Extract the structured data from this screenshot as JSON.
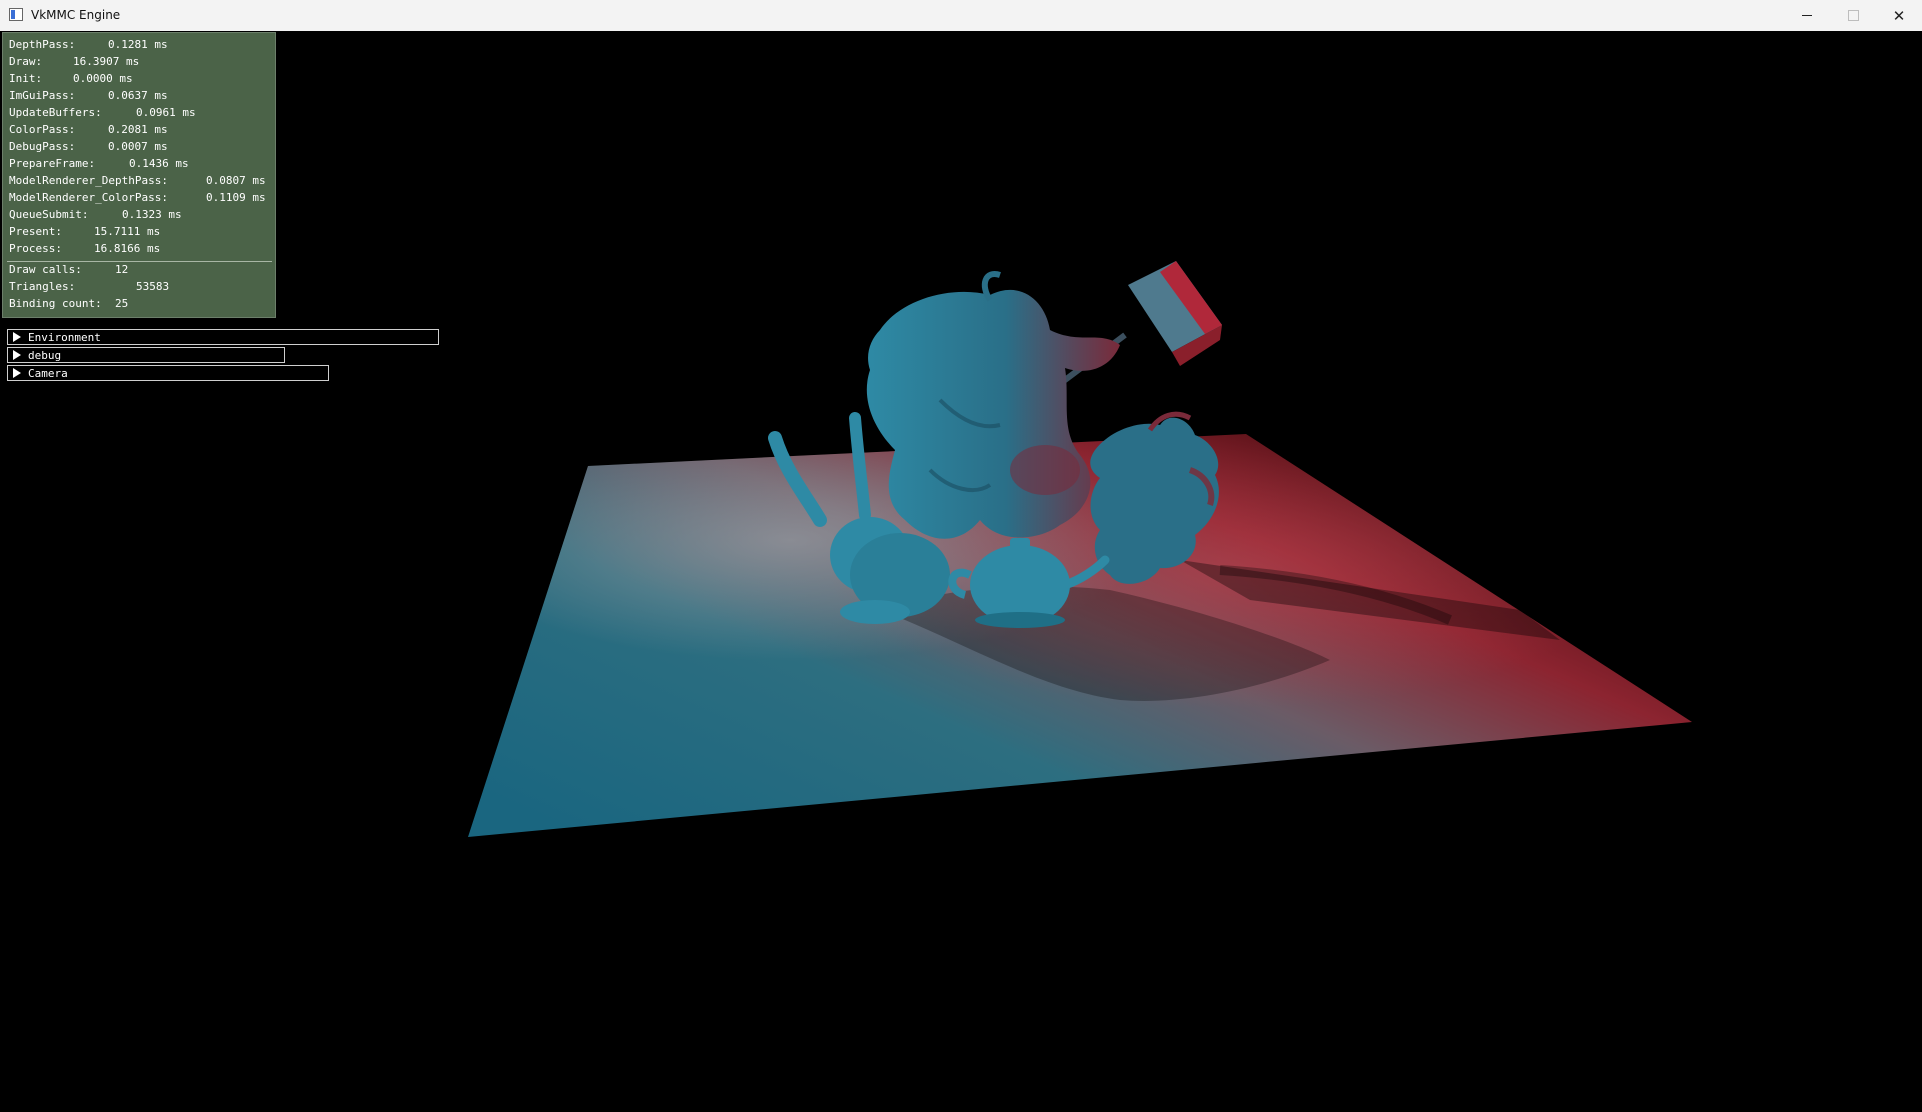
{
  "window": {
    "title": "VkMMC Engine",
    "icon": "app-window-icon",
    "controls": [
      "minimize-icon",
      "maximize-icon",
      "close-icon"
    ]
  },
  "stats": {
    "timings": [
      {
        "label": "DepthPass:",
        "value": "0.1281 ms"
      },
      {
        "label": "Draw:",
        "value": "16.3907 ms"
      },
      {
        "label": "Init:",
        "value": "0.0000 ms"
      },
      {
        "label": "ImGuiPass:",
        "value": "0.0637 ms"
      },
      {
        "label": "UpdateBuffers:",
        "value": "0.0961 ms"
      },
      {
        "label": "ColorPass:",
        "value": "0.2081 ms"
      },
      {
        "label": "DebugPass:",
        "value": "0.0007 ms"
      },
      {
        "label": "PrepareFrame:",
        "value": "0.1436 ms"
      },
      {
        "label": "ModelRenderer_DepthPass:",
        "value": "0.0807 ms"
      },
      {
        "label": "ModelRenderer_ColorPass:",
        "value": "0.1109 ms"
      },
      {
        "label": "QueueSubmit:",
        "value": "0.1323 ms"
      },
      {
        "label": "Present:",
        "value": "15.7111 ms"
      },
      {
        "label": "Process:",
        "value": "16.8166 ms"
      }
    ],
    "counters": [
      {
        "label": "Draw calls:",
        "value": "12"
      },
      {
        "label": "Triangles:",
        "value": "53583"
      },
      {
        "label": "Binding count:",
        "value": "25"
      }
    ]
  },
  "panels": [
    {
      "label": "Environment",
      "icon": "collapse-arrow-icon"
    },
    {
      "label": "debug",
      "icon": "collapse-arrow-icon"
    },
    {
      "label": "Camera",
      "icon": "collapse-arrow-icon"
    }
  ],
  "colors": {
    "overlay_bg": "#4b6348",
    "light_red": "#c0101a",
    "light_cyan": "#1f6f86",
    "model_color": "#2a7f98"
  }
}
